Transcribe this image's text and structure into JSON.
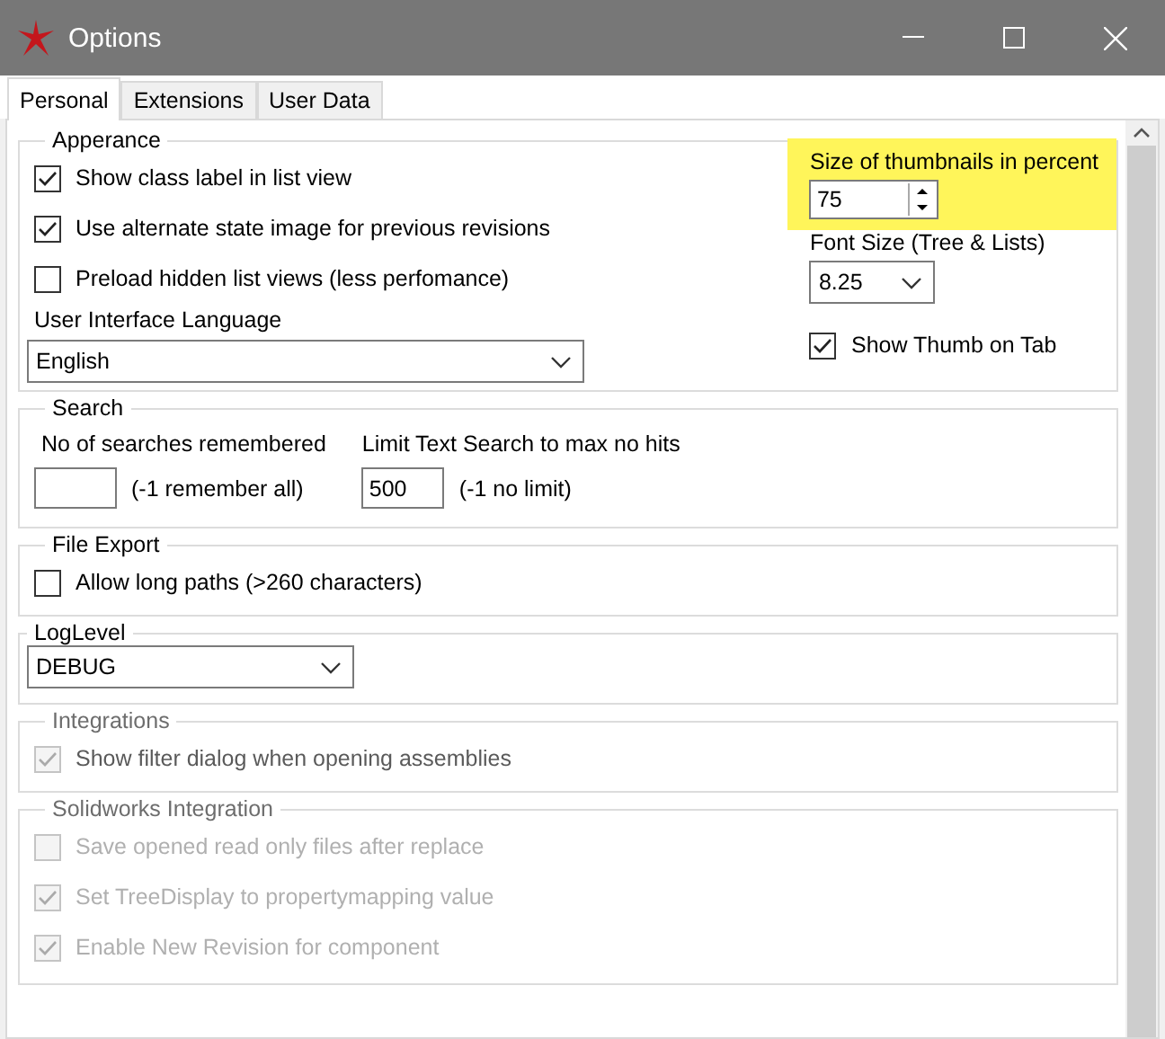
{
  "window": {
    "title": "Options"
  },
  "tabs": [
    {
      "label": "Personal",
      "selected": true
    },
    {
      "label": "Extensions",
      "selected": false
    },
    {
      "label": "User Data",
      "selected": false
    }
  ],
  "appearance": {
    "title": "Apperance",
    "checkboxes": [
      {
        "label": "Show class label in list view",
        "checked": true
      },
      {
        "label": "Use alternate state image for previous revisions",
        "checked": true
      },
      {
        "label": "Preload hidden list views (less perfomance)",
        "checked": false
      }
    ],
    "language": {
      "label": "User Interface Language",
      "value": "English"
    },
    "thumbnails": {
      "label": "Size of thumbnails in percent",
      "value": "75",
      "highlighted": true
    },
    "font_size": {
      "label": "Font Size (Tree & Lists)",
      "value": "8.25"
    },
    "show_thumb": {
      "label": "Show Thumb on Tab",
      "checked": true
    }
  },
  "search": {
    "title": "Search",
    "fields": [
      {
        "label": "No of searches remembered",
        "hint": "(-1 remember all)"
      },
      {
        "label": "Limit Text Search to max no hits",
        "value": "500",
        "hint": "(-1 no limit)"
      }
    ]
  },
  "file_export": {
    "title": "File Export",
    "checkboxes": [
      {
        "label": "Allow long paths (>260 characters)",
        "checked": false
      }
    ]
  },
  "log_level": {
    "title": "LogLevel",
    "value": "DEBUG"
  },
  "integrations": {
    "title": "Integrations",
    "disabled": true,
    "checkboxes": [
      {
        "label": "Show filter dialog when opening assemblies",
        "checked": true
      }
    ]
  },
  "solidworks": {
    "title": "Solidworks Integration",
    "disabled": true,
    "checkboxes": [
      {
        "label": "Save opened read only files after replace",
        "checked": false
      },
      {
        "label": "Set TreeDisplay to propertymapping value",
        "checked": true
      },
      {
        "label": "Enable New Revision for component",
        "checked": true
      }
    ]
  }
}
